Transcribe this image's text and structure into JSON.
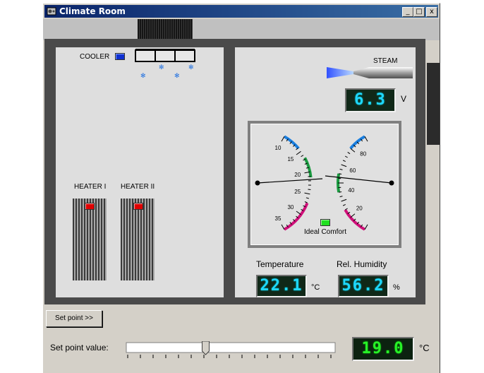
{
  "window": {
    "title": "Climate Room",
    "minimize": "_",
    "maximize": "□",
    "close": "x"
  },
  "cooler": {
    "label": "COOLER",
    "indicator_color": "#1030d0"
  },
  "steam": {
    "label": "STEAM",
    "display": "6.3",
    "unit": "V"
  },
  "heaters": [
    {
      "label": "HEATER I",
      "indicator_color": "#e00000"
    },
    {
      "label": "HEATER II",
      "indicator_color": "#e00000"
    }
  ],
  "gauge": {
    "temperature_ticks": [
      "10",
      "15",
      "20",
      "25",
      "30",
      "35"
    ],
    "humidity_ticks": [
      "80",
      "60",
      "40",
      "20"
    ],
    "legend": "Ideal Comfort",
    "legend_color": "#20e020"
  },
  "readouts": {
    "temperature": {
      "label": "Temperature",
      "value": "22.1",
      "unit": "°C"
    },
    "humidity": {
      "label": "Rel. Humidity",
      "value": "56.2",
      "unit": "%"
    }
  },
  "controls": {
    "setpoint_button": "Set point >>",
    "setpoint_label": "Set point value:",
    "setpoint_display": "19.0",
    "setpoint_unit": "°C",
    "slider_fraction": 0.38
  },
  "colors": {
    "lcd_cyan": "#1fd8ff",
    "lcd_green": "#28f028",
    "arc_blue": "#1a7fe0",
    "arc_green": "#1a9a40",
    "arc_magenta": "#d0107a"
  }
}
